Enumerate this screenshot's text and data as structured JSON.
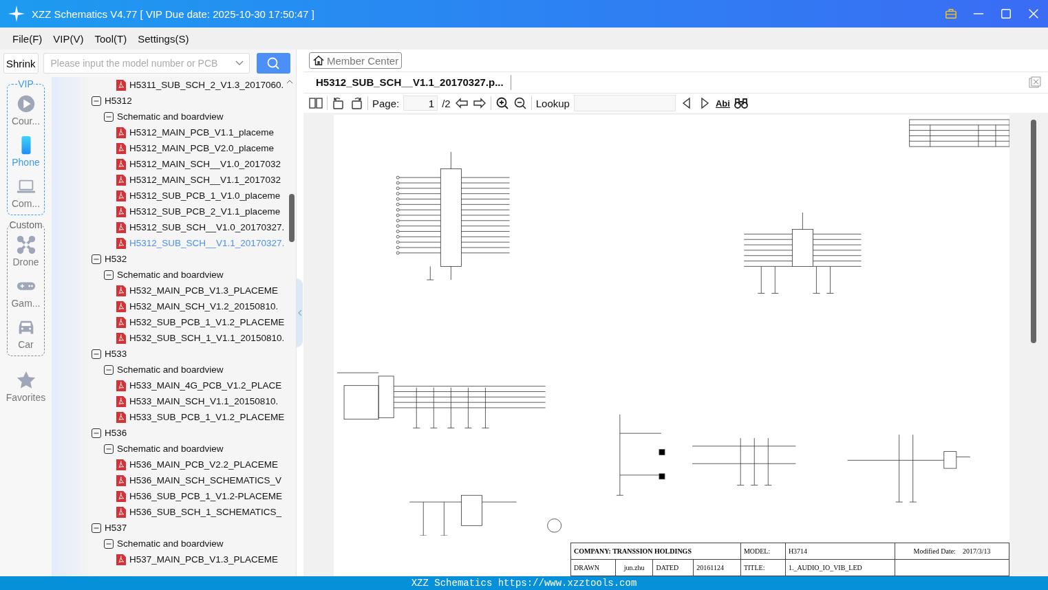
{
  "window": {
    "title": "XZZ Schematics V4.77 [ VIP Due date: 2025-10-30 17:50:47 ]"
  },
  "menu": [
    "File(F)",
    "VIP(V)",
    "Tool(T)",
    "Settings(S)"
  ],
  "search": {
    "shrink": "Shrink",
    "placeholder": "Please input the model number or PCB"
  },
  "categories": [
    {
      "label": "VIP",
      "items": [
        {
          "label": "Cour...",
          "kind": "play",
          "selected": false
        },
        {
          "label": "Phone",
          "kind": "phone",
          "selected": true
        },
        {
          "label": "Com...",
          "kind": "laptop",
          "selected": false
        }
      ]
    },
    {
      "label": "Custom",
      "items": [
        {
          "label": "Drone",
          "kind": "drone",
          "selected": false
        },
        {
          "label": "Gam...",
          "kind": "gamepad",
          "selected": false
        },
        {
          "label": "Car",
          "kind": "car",
          "selected": false
        }
      ]
    }
  ],
  "favorites": {
    "label": "Favorites"
  },
  "tree": [
    {
      "kind": "file",
      "label": "H5311_SUB_SCH_2_V1.3_2017060.",
      "selected": false
    },
    {
      "kind": "model",
      "label": "H5312",
      "expanded": true,
      "children": [
        {
          "kind": "folder",
          "label": "Schematic and boardview",
          "expanded": true,
          "children": [
            {
              "kind": "file",
              "label": "H5312_MAIN_PCB_V1.1_placeme",
              "selected": false
            },
            {
              "kind": "file",
              "label": "H5312_MAIN_PCB_V2.0_placeme",
              "selected": false
            },
            {
              "kind": "file",
              "label": "H5312_MAIN_SCH__V1.0_2017032",
              "selected": false
            },
            {
              "kind": "file",
              "label": "H5312_MAIN_SCH__V1.1_2017032",
              "selected": false
            },
            {
              "kind": "file",
              "label": "H5312_SUB_PCB_1_V1.0_placeme",
              "selected": false
            },
            {
              "kind": "file",
              "label": "H5312_SUB_PCB_2_V1.1_placeme",
              "selected": false
            },
            {
              "kind": "file",
              "label": "H5312_SUB_SCH__V1.0_20170327.",
              "selected": false
            },
            {
              "kind": "file",
              "label": "H5312_SUB_SCH__V1.1_20170327.",
              "selected": true
            }
          ]
        }
      ]
    },
    {
      "kind": "model",
      "label": "H532",
      "expanded": true,
      "children": [
        {
          "kind": "folder",
          "label": "Schematic and boardview",
          "expanded": true,
          "children": [
            {
              "kind": "file",
              "label": "H532_MAIN_PCB_V1.3_PLACEME",
              "selected": false
            },
            {
              "kind": "file",
              "label": "H532_MAIN_SCH_V1.2_20150810.",
              "selected": false
            },
            {
              "kind": "file",
              "label": "H532_SUB_PCB_1_V1.2_PLACEME",
              "selected": false
            },
            {
              "kind": "file",
              "label": "H532_SUB_SCH_1_V1.1_20150810.",
              "selected": false
            }
          ]
        }
      ]
    },
    {
      "kind": "model",
      "label": "H533",
      "expanded": true,
      "children": [
        {
          "kind": "folder",
          "label": "Schematic and boardview",
          "expanded": true,
          "children": [
            {
              "kind": "file",
              "label": "H533_MAIN_4G_PCB_V1.2_PLACE",
              "selected": false
            },
            {
              "kind": "file",
              "label": "H533_MAIN_SCH_V1.1_20150810.",
              "selected": false
            },
            {
              "kind": "file",
              "label": "H533_SUB_PCB_1_V1.2_PLACEME",
              "selected": false
            }
          ]
        }
      ]
    },
    {
      "kind": "model",
      "label": "H536",
      "expanded": true,
      "children": [
        {
          "kind": "folder",
          "label": "Schematic and boardview",
          "expanded": true,
          "children": [
            {
              "kind": "file",
              "label": "H536_MAIN_PCB_V2.2_PLACEME",
              "selected": false
            },
            {
              "kind": "file",
              "label": "H536_MAIN_SCH_SCHEMATICS_V",
              "selected": false
            },
            {
              "kind": "file",
              "label": "H536_SUB_PCB_1_V1.2-PLACEME",
              "selected": false
            },
            {
              "kind": "file",
              "label": "H536_SUB_SCH_1_SCHEMATICS_",
              "selected": false
            }
          ]
        }
      ]
    },
    {
      "kind": "model",
      "label": "H537",
      "expanded": true,
      "children": [
        {
          "kind": "folder",
          "label": "Schematic and boardview",
          "expanded": true,
          "children": [
            {
              "kind": "file",
              "label": "H537_MAIN_PCB_V1.3_PLACEME",
              "selected": false
            }
          ]
        }
      ]
    }
  ],
  "viewer": {
    "member_center": "Member Center",
    "tabs": [
      {
        "label": "H5312_SUB_SCH__V1.1_20170327.p...",
        "selected": true
      }
    ],
    "toolbar": {
      "page_label": "Page:",
      "page": "1",
      "total": "/2",
      "lookup_label": "Lookup",
      "match_case": "Abi"
    },
    "title_block": {
      "company": "COMPANY: TRANSSION HOLDINGS",
      "model_label": "MODEL:",
      "model": "H3714",
      "modified_label": "Modified Date:",
      "modified": "2017/3/13",
      "drawn_label": "DRAWN",
      "drawn": "jun.zhu",
      "dated_label": "DATED",
      "dated": "20161124",
      "title_label": "TITLE:",
      "title": "1._AUDIO_IO_VIB_LED"
    }
  },
  "status_bar": "XZZ Schematics https://www.xzztools.com"
}
